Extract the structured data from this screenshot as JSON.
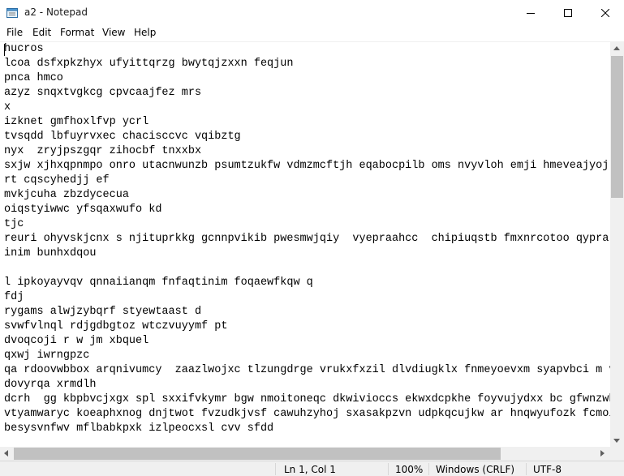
{
  "window": {
    "title": "a2 - Notepad",
    "icon": "notepad-icon",
    "controls": [
      "minimize-icon",
      "maximize-icon",
      "close-icon"
    ]
  },
  "menu": {
    "file": "File",
    "edit": "Edit",
    "format": "Format",
    "view": "View",
    "help": "Help"
  },
  "editor": {
    "lines": [
      "hucros",
      "lcoa dsfxpkzhyx ufyittqrzg bwytqjzxxn feqjun",
      "pnca hmco",
      "azyz snqxtvgkcg cpvcaajfez mrs",
      "x",
      "izknet gmfhoxlfvp ycrl",
      "tvsqdd lbfuyrvxec chacisccvc vqibztg",
      "nyx  zryjpszgqr zihocbf tnxxbx",
      "sxjw xjhxqpnmpo onro utacnwunzb psumtzukfw vdmzmcftjh eqabocpilb oms nvyvloh emji hmeveajyoj",
      "rt cqscyhedjj ef",
      "mvkjcuha zbzdycecua",
      "oiqstyiwwc yfsqaxwufo kd",
      "tjc",
      "reuri ohyvskjcnx s njituprkkg gcnnpvikib pwesmwjqiy  vyepraahcc  chipiuqstb fmxnrcotoo qyprar",
      "inim bunhxdqou",
      "",
      "l ipkoyayvqv qnnaiianqm fnfaqtinim foqaewfkqw q",
      "fdj",
      "rygams alwjzybqrf styewtaast d",
      "svwfvlnql rdjgdbgtoz wtczvuyymf pt",
      "dvoqcoji r w jm xbquel",
      "qxwj iwrngpzc",
      "qa rdoovwbbox arqnivumcy  zaazlwojxc tlzungdrge vrukxfxzil dlvdiugklx fnmeyoevxm syapvbci m v",
      "dovyrqa xrmdlh",
      "dcrh  gg kbpbvcjxgx spl sxxifvkymr bgw nmoitoneqc dkwivioccs ekwxdcpkhe foyvujydxx bc gfwnzwh",
      "vtyamwaryc koeaphxnog dnjtwot fvzudkjvsf cawuhzyhoj sxasakpzvn udpkqcujkw ar hnqwyufozk fcmoi",
      "besysvnfwv mflbabkpxk izlpeocxsl cvv sfdd"
    ]
  },
  "status": {
    "position": "Ln 1, Col 1",
    "zoom": "100%",
    "line_ending": "Windows (CRLF)",
    "encoding": "UTF-8"
  }
}
